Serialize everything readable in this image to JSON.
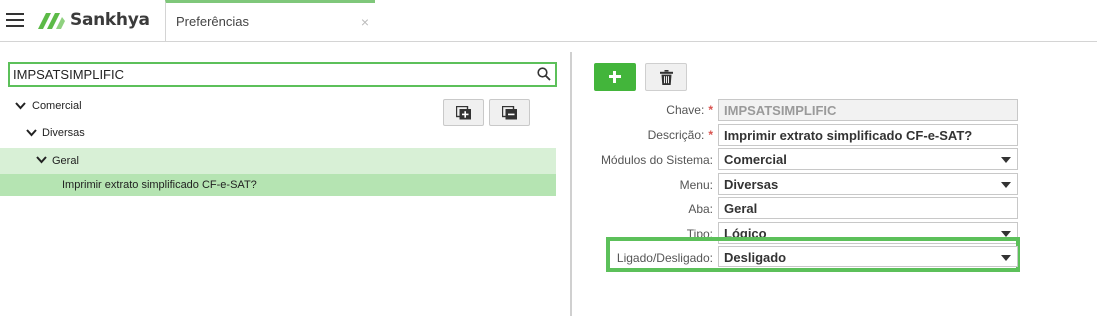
{
  "app": {
    "logo_text": "Sankhya"
  },
  "tab": {
    "label": "Preferências",
    "close_glyph": "×"
  },
  "search": {
    "value": "IMPSATSIMPLIFIC"
  },
  "tree": {
    "level1": "Comercial",
    "level2": "Diversas",
    "level3": "Geral",
    "item": "Imprimir extrato simplificado CF-e-SAT?"
  },
  "form": {
    "chave_label": "Chave:",
    "chave_value": "IMPSATSIMPLIFIC",
    "descricao_label": "Descrição:",
    "descricao_value": "Imprimir extrato simplificado CF-e-SAT?",
    "modulos_label": "Módulos do Sistema:",
    "modulos_value": "Comercial",
    "menu_label": "Menu:",
    "menu_value": "Diversas",
    "aba_label": "Aba:",
    "aba_value": "Geral",
    "tipo_label": "Tipo:",
    "tipo_value": "Lógico",
    "ligado_label": "Ligado/Desligado:",
    "ligado_value": "Desligado",
    "required_mark": "*"
  },
  "colors": {
    "accent_green": "#43b53b",
    "highlight_green": "#5cc05a",
    "selected_row": "#b5e4b2",
    "group_row": "#d8f0d6"
  },
  "icons": [
    "menu-icon",
    "sankhya-logo-icon",
    "close-icon",
    "search-icon",
    "chevron-down-icon",
    "expand-all-icon",
    "collapse-all-icon",
    "plus-icon",
    "trash-icon",
    "dropdown-caret-icon"
  ]
}
